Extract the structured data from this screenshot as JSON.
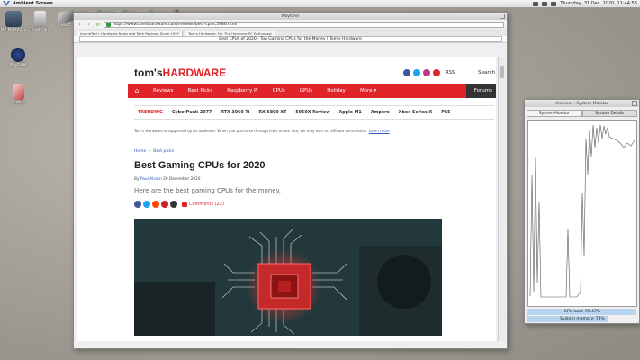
{
  "menubar": {
    "app_name": "Ambient Screen",
    "datetime": "Thursday, 31 Dec. 2020, 11:44:56"
  },
  "desktop": {
    "icons": [
      {
        "label": "My MorphOS"
      },
      {
        "label": "Trashcan"
      },
      {
        "label": "Boot"
      },
      {
        "label": "Wayfarer"
      },
      {
        "label": "Sketch"
      }
    ]
  },
  "browser": {
    "window_title": "Wayfarer",
    "back": "‹",
    "forward": "›",
    "reload": "↻",
    "url": "https://www.tomshardware.com/reviews/best-cpus,5986.html",
    "tabs": [
      {
        "label": "AnandTech: Hardware News and Tech Reviews Since 1997"
      },
      {
        "label": "Tom's Hardware: For The Hardcore PC Enthusiast"
      }
    ],
    "page_title": "Best CPUs of 2020 - Top Gaming CPUs for the Money | Tom's Hardware"
  },
  "site": {
    "brand_a": "tom's",
    "brand_b": "HARDWARE",
    "rss": "RSS",
    "search": "Search",
    "nav": {
      "home": "⌂",
      "items": [
        "Reviews",
        "Best Picks",
        "Raspberry Pi",
        "CPUs",
        "GPUs",
        "Holiday",
        "More ▾"
      ],
      "forums": "Forums"
    },
    "trending": {
      "label": "TRENDING",
      "items": [
        "CyberPunk 2077",
        "RTX 3060 Ti",
        "RX 6800 XT",
        "5950X Review",
        "Apple M1",
        "Ampere",
        "Xbox Series X",
        "PS5"
      ]
    },
    "affiliate_text": "Tom's Hardware is supported by its audience. When you purchase through links on our site, we may earn an affiliate commission.",
    "affiliate_link": "Learn more",
    "breadcrumbs": [
      "Home",
      "Best-picks"
    ],
    "headline": "Best Gaming CPUs for 2020",
    "byline_prefix": "By",
    "author": "Paul Alcorn",
    "date": "26 December 2020",
    "standfirst": "Here are the best gaming CPUs for the money.",
    "comments": "Comments (22)"
  },
  "sysmon": {
    "title": "Ambient : System Monitor",
    "tabs": [
      "System Monitor",
      "System Details"
    ],
    "cpu_label": "CPU load: 99.47%",
    "cpu_value": 99.47,
    "mem_label": "System memory: 74%",
    "mem_value": 74
  }
}
